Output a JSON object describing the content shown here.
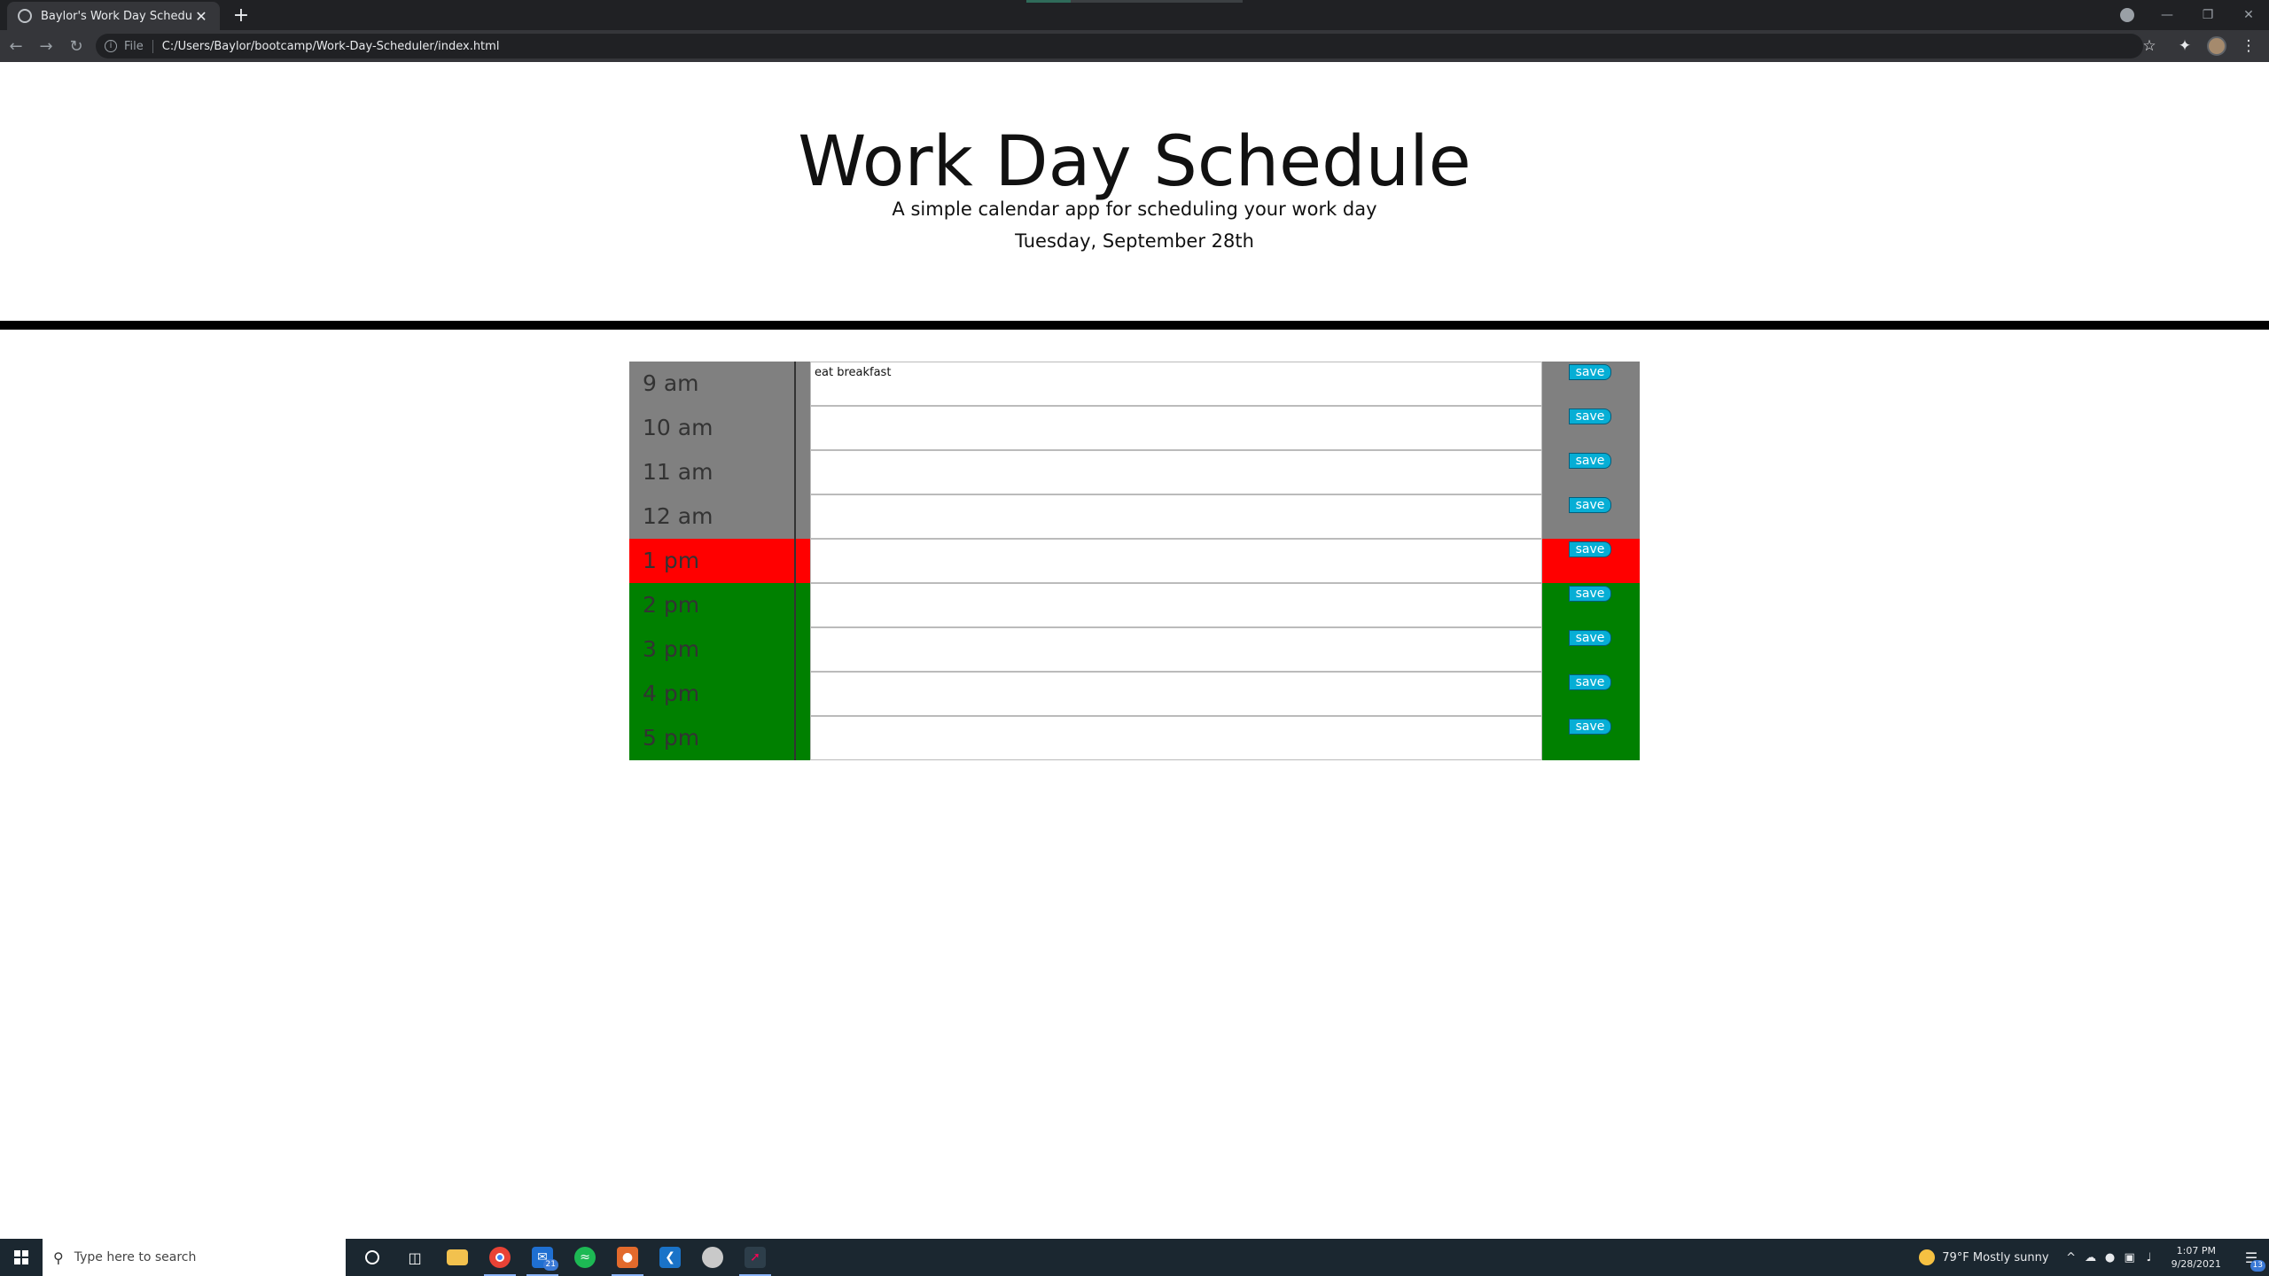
{
  "browser": {
    "tab_title": "Baylor's Work Day Scheduler",
    "tab_close": "✕",
    "new_tab": "+",
    "scheme_label": "File",
    "url": "C:/Users/Baylor/bootcamp/Work-Day-Scheduler/index.html",
    "icons": [
      "back-icon",
      "forward-icon",
      "reload-icon",
      "info-icon",
      "star-icon",
      "extensions-icon",
      "avatar",
      "menu-icon"
    ]
  },
  "page": {
    "title": "Work Day Schedule",
    "lead": "A simple calendar app for scheduling your work day",
    "current_day": "Tuesday, September 28th"
  },
  "schedule": {
    "save_label": "save",
    "colors": {
      "past": "#808080",
      "present": "#ff0000",
      "future": "#008000",
      "save_button": "#06aed5"
    },
    "rows": [
      {
        "hour": "9 am",
        "task": "eat breakfast",
        "state": "past"
      },
      {
        "hour": "10 am",
        "task": "",
        "state": "past"
      },
      {
        "hour": "11 am",
        "task": "",
        "state": "past"
      },
      {
        "hour": "12 am",
        "task": "",
        "state": "past"
      },
      {
        "hour": "1 pm",
        "task": "",
        "state": "present"
      },
      {
        "hour": "2 pm",
        "task": "",
        "state": "future"
      },
      {
        "hour": "3 pm",
        "task": "",
        "state": "future"
      },
      {
        "hour": "4 pm",
        "task": "",
        "state": "future"
      },
      {
        "hour": "5 pm",
        "task": "",
        "state": "future"
      }
    ]
  },
  "taskbar": {
    "search_placeholder": "Type here to search",
    "mail_badge": "21",
    "weather": "79°F  Mostly sunny",
    "time": "1:07 PM",
    "date": "9/28/2021",
    "notification_badge": "13"
  }
}
